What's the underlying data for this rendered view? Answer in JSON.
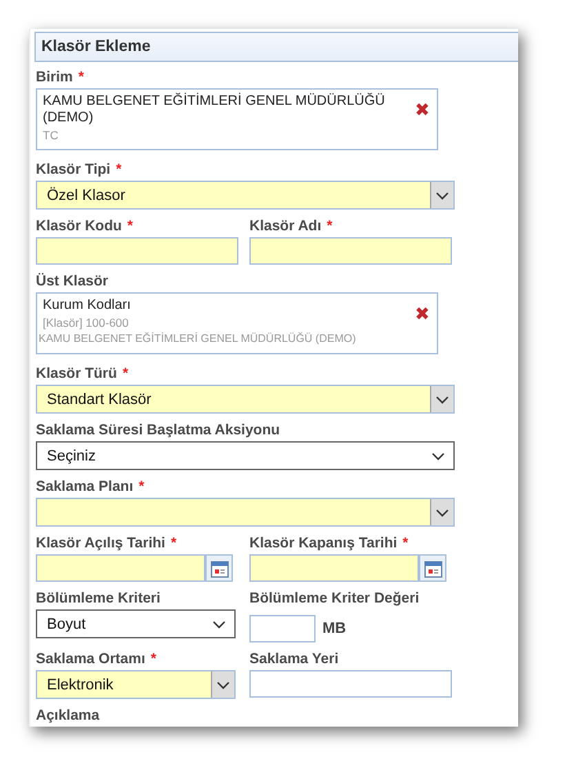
{
  "panel": {
    "title": "Klasör Ekleme"
  },
  "rows": [
    {
      "fields": [
        {
          "kind": "selection-box",
          "label": "Birim",
          "mark": "*",
          "lines": [
            {
              "kind": "main",
              "text": "KAMU BELGENET EĞİTİMLERİ GENEL MÜDÜRLÜĞÜ (DEMO)"
            },
            {
              "kind": "sub",
              "text": "TC"
            }
          ],
          "remove": "✖"
        }
      ]
    },
    {
      "fields": [
        {
          "kind": "select",
          "label": "Klasör Tipi",
          "mark": "*",
          "required": true,
          "value": "Özel Klasor"
        }
      ]
    },
    {
      "fields": [
        {
          "kind": "input",
          "label": "Klasör Kodu",
          "mark": "*",
          "required": true
        },
        {
          "kind": "input",
          "label": "Klasör Adı",
          "mark": "*",
          "required": true
        }
      ]
    },
    {
      "fields": [
        {
          "kind": "selection-box",
          "label": "Üst Klasör",
          "lines": [
            {
              "kind": "main",
              "text": "Kurum Kodları"
            },
            {
              "kind": "sub",
              "text": "[Klasör] 100-600"
            },
            {
              "kind": "note",
              "text": "KAMU BELGENET EĞİTİMLERİ GENEL MÜDÜRLÜĞÜ (DEMO)"
            }
          ],
          "remove": "✖"
        }
      ]
    },
    {
      "fields": [
        {
          "kind": "select",
          "label": "Klasör Türü",
          "mark": "*",
          "required": true,
          "value": "Standart Klasör"
        }
      ]
    },
    {
      "fields": [
        {
          "kind": "select",
          "label": "Saklama Süresi Başlatma Aksiyonu",
          "required": false,
          "value": "Seçiniz"
        }
      ]
    },
    {
      "fields": [
        {
          "kind": "select",
          "label": "Saklama Planı",
          "mark": "*",
          "required": true
        }
      ]
    },
    {
      "fields": [
        {
          "kind": "date",
          "label": "Klasör Açılış Tarihi",
          "mark": "*",
          "required": true
        },
        {
          "kind": "date",
          "label": "Klasör Kapanış Tarihi",
          "mark": "*",
          "required": true
        }
      ]
    },
    {
      "fields": [
        {
          "kind": "select",
          "label": "Bölümleme Kriteri",
          "required": false,
          "value": "Boyut"
        },
        {
          "kind": "unit-input",
          "label": "Bölümleme Kriter Değeri",
          "required": false,
          "unit": "MB"
        }
      ]
    },
    {
      "fields": [
        {
          "kind": "select",
          "label": "Saklama Ortamı",
          "mark": "*",
          "required": true,
          "value": "Elektronik"
        },
        {
          "kind": "input",
          "label": "Saklama Yeri",
          "required": false
        }
      ]
    },
    {
      "fields": [
        {
          "kind": "label-only",
          "label": "Açıklama"
        }
      ]
    }
  ]
}
